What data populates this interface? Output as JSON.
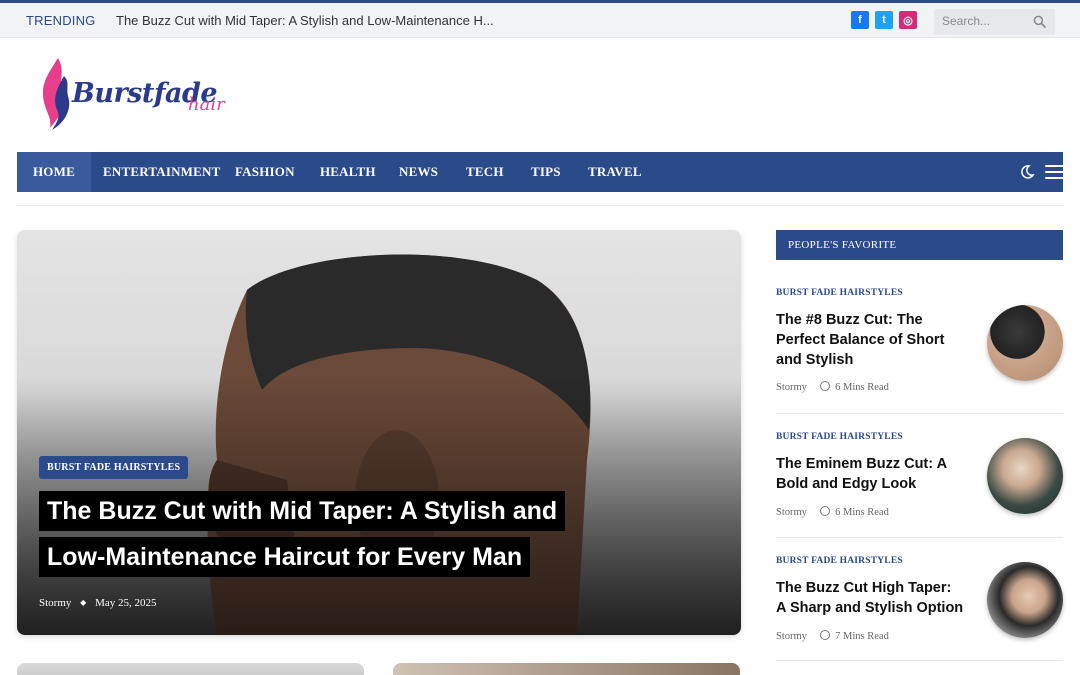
{
  "topbar": {
    "trending_label": "TRENDING",
    "trending_text": "The Buzz Cut with Mid Taper: A Stylish and Low-Maintenance H...",
    "social": [
      {
        "icon": "facebook-icon",
        "glyph": "f",
        "color": "#1877f2"
      },
      {
        "icon": "twitter-icon",
        "glyph": "t",
        "color": "#1da1f2"
      },
      {
        "icon": "instagram-icon",
        "glyph": "◎",
        "color": "#d62976"
      }
    ],
    "search_placeholder": "Search..."
  },
  "logo": {
    "text": "Burstfade",
    "subtext": "hair"
  },
  "nav": {
    "items": [
      "HOME",
      "ENTERTAINMENT",
      "FASHION",
      "HEALTH",
      "NEWS",
      "TECH",
      "TIPS",
      "TRAVEL"
    ],
    "active": "HOME"
  },
  "hero": {
    "category": "BURST FADE HAIRSTYLES",
    "title_line1": "The Buzz Cut with Mid Taper: A Stylish and",
    "title_line2": "Low-Maintenance Haircut for Every Man",
    "author": "Stormy",
    "date": "May 25, 2025"
  },
  "sidebar": {
    "heading": "PEOPLE'S FAVORITE",
    "items": [
      {
        "category": "BURST FADE HAIRSTYLES",
        "title_lines": [
          "The #8 Buzz Cut: The",
          "Perfect Balance of Short",
          "and Stylish"
        ],
        "author": "Stormy",
        "read_time": "6 Mins Read"
      },
      {
        "category": "BURST FADE HAIRSTYLES",
        "title_lines": [
          "The Eminem Buzz Cut: A",
          "Bold and Edgy Look"
        ],
        "author": "Stormy",
        "read_time": "6 Mins Read"
      },
      {
        "category": "BURST FADE HAIRSTYLES",
        "title_lines": [
          "The Buzz Cut High Taper:",
          "A Sharp and Stylish Option"
        ],
        "author": "Stormy",
        "read_time": "7 Mins Read"
      }
    ]
  },
  "colors": {
    "brand": "#2b4a8a",
    "logo_pink": "#e83e8c",
    "logo_navy": "#2b3a8a"
  }
}
